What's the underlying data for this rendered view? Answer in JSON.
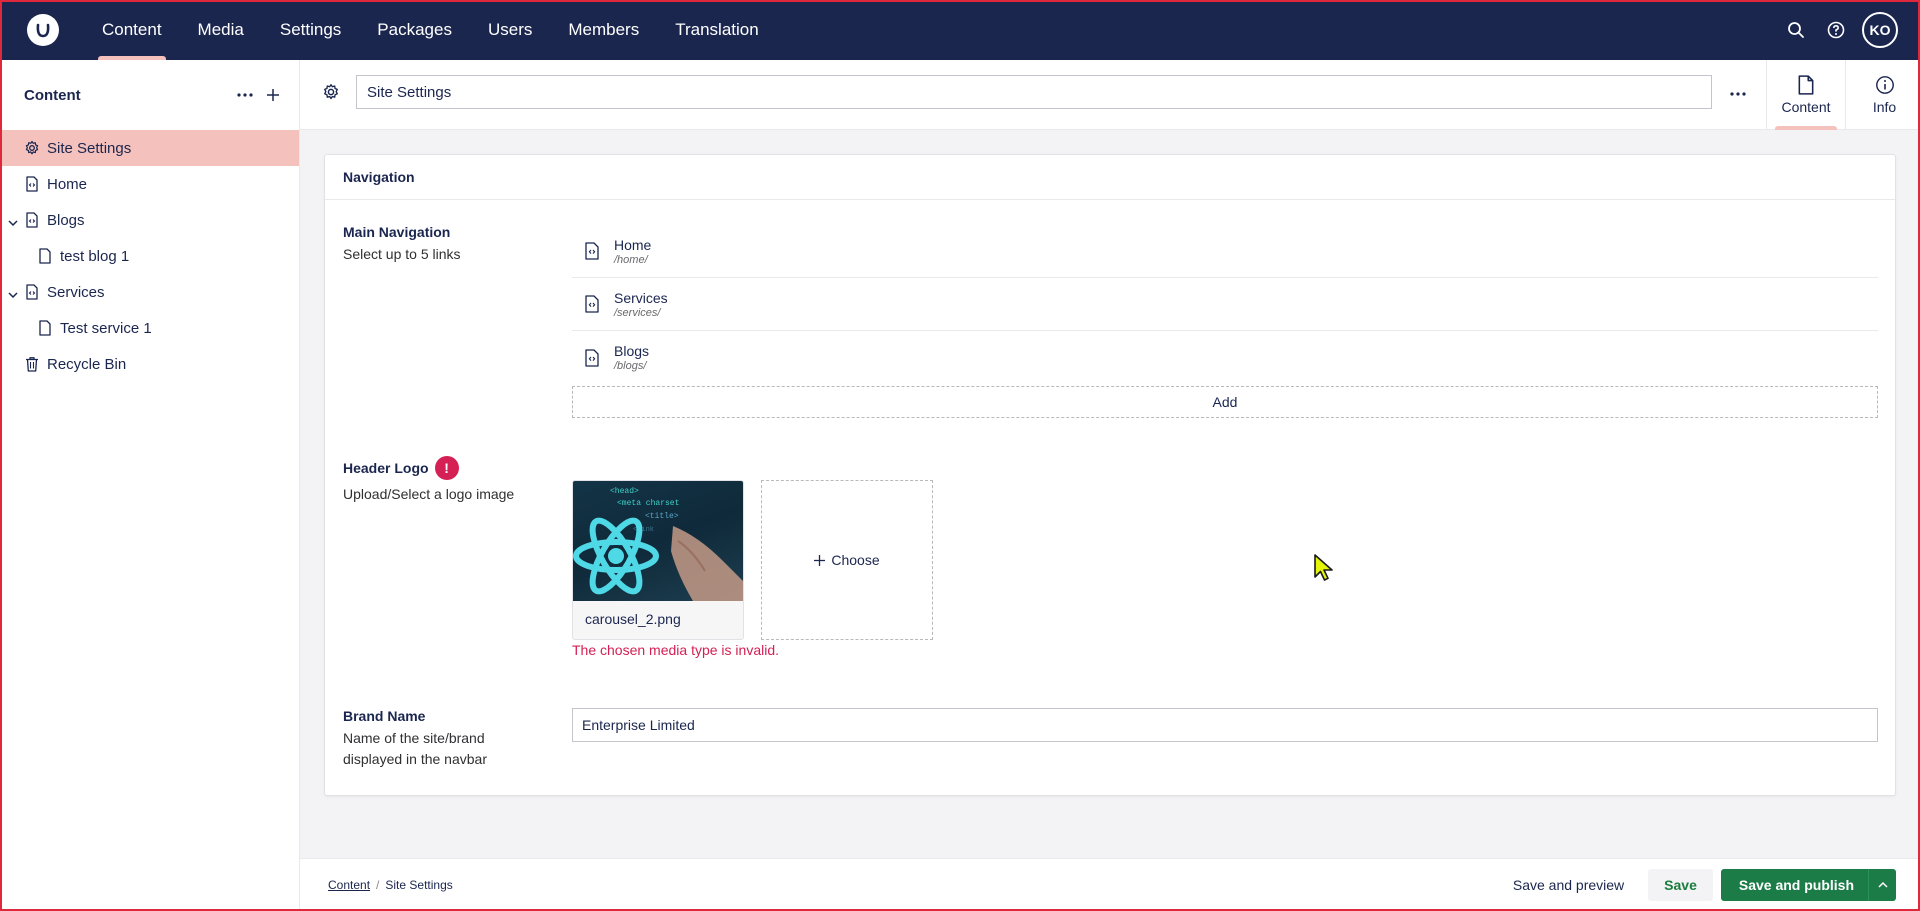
{
  "topnav": {
    "items": [
      {
        "label": "Content",
        "active": true
      },
      {
        "label": "Media"
      },
      {
        "label": "Settings"
      },
      {
        "label": "Packages"
      },
      {
        "label": "Users"
      },
      {
        "label": "Members"
      },
      {
        "label": "Translation"
      }
    ],
    "icons": [
      "search-icon",
      "help-icon"
    ],
    "avatar_initials": "KO"
  },
  "sidebar": {
    "title": "Content",
    "tree": [
      {
        "label": "Site Settings",
        "icon": "settings-icon",
        "selected": true
      },
      {
        "label": "Home",
        "icon": "document-icon"
      },
      {
        "label": "Blogs",
        "icon": "document-icon",
        "expanded": true
      },
      {
        "label": "test blog 1",
        "icon": "page-icon"
      },
      {
        "label": "Services",
        "icon": "document-icon",
        "expanded": true
      },
      {
        "label": "Test service 1",
        "icon": "page-icon"
      },
      {
        "label": "Recycle Bin",
        "icon": "trash-icon"
      }
    ]
  },
  "header": {
    "name_value": "Site Settings",
    "tabs": [
      {
        "label": "Content",
        "icon": "document-icon",
        "active": true
      },
      {
        "label": "Info",
        "icon": "info-icon"
      }
    ]
  },
  "card": {
    "group_title": "Navigation",
    "main_navigation": {
      "label": "Main Navigation",
      "description": "Select up to 5 links",
      "links": [
        {
          "name": "Home",
          "url": "/home/"
        },
        {
          "name": "Services",
          "url": "/services/"
        },
        {
          "name": "Blogs",
          "url": "/blogs/"
        }
      ],
      "add_label": "Add"
    },
    "header_logo": {
      "label": "Header Logo",
      "error_badge": "!",
      "description": "Upload/Select a logo image",
      "media_name": "carousel_2.png",
      "choose_label": "Choose",
      "error_message": "The chosen media type is invalid."
    },
    "brand_name": {
      "label": "Brand Name",
      "description": "Name of the site/brand displayed in the navbar",
      "value": "Enterprise Limited"
    }
  },
  "footer": {
    "breadcrumb": [
      "Content",
      "Site Settings"
    ],
    "save_preview_label": "Save and preview",
    "save_label": "Save",
    "publish_label": "Save and publish"
  },
  "colors": {
    "topbar": "#1b264f",
    "accent": "#f5c1bc",
    "publish": "#1b7c47",
    "error": "#d42054"
  }
}
